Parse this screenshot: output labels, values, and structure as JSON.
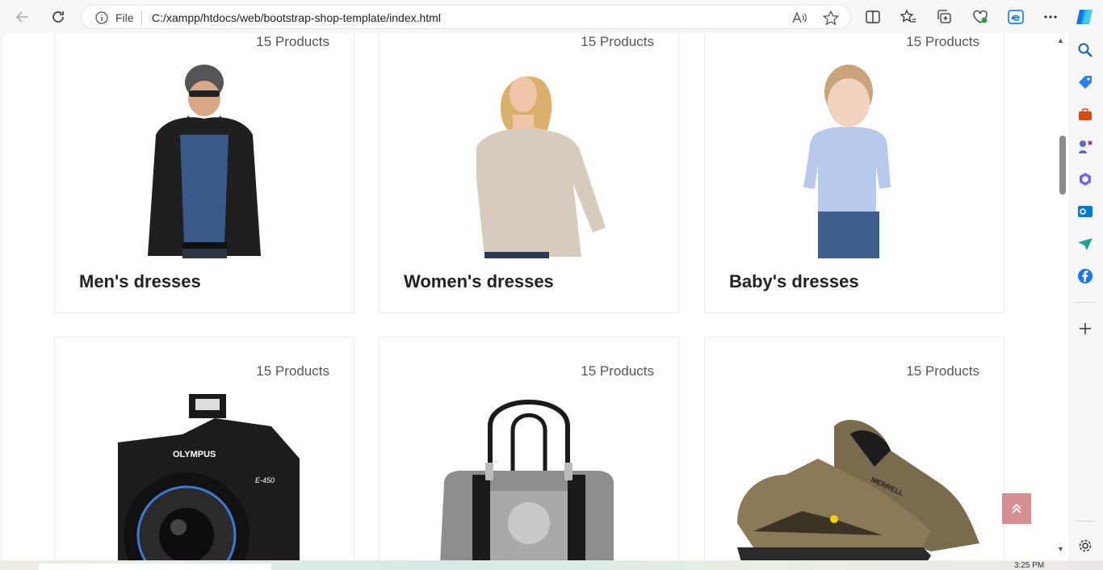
{
  "browser": {
    "address_label": "File",
    "url": "C:/xampp/htdocs/web/bootstrap-shop-template/index.html",
    "clock": "3:25 PM"
  },
  "categories": [
    {
      "title": "Men's dresses",
      "count": "15 Products"
    },
    {
      "title": "Women's dresses",
      "count": "15 Products"
    },
    {
      "title": "Baby's dresses",
      "count": "15 Products"
    },
    {
      "title": "",
      "count": "15 Products"
    },
    {
      "title": "",
      "count": "15 Products"
    },
    {
      "title": "",
      "count": "15 Products"
    }
  ],
  "product_brand_labels": {
    "camera": "OLYMPUS",
    "camera_model": "E-450",
    "shoe": "MERRELL"
  },
  "icons": {
    "back": "back-arrow-icon",
    "refresh": "refresh-icon",
    "back_to_top": "chevron-double-up-icon"
  },
  "colors": {
    "back_to_top": "#d88e8e"
  }
}
